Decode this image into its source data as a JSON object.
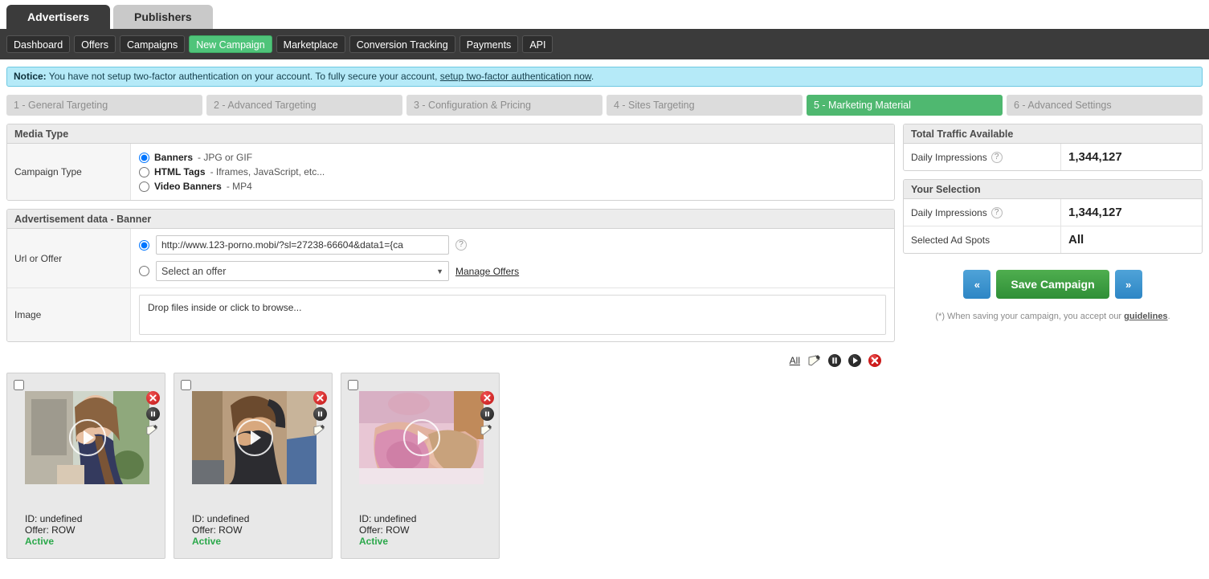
{
  "account_tabs": [
    {
      "label": "Advertisers",
      "active": true
    },
    {
      "label": "Publishers",
      "active": false
    }
  ],
  "nav": {
    "items": [
      {
        "label": "Dashboard",
        "selected": false
      },
      {
        "label": "Offers",
        "selected": false
      },
      {
        "label": "Campaigns",
        "selected": false
      },
      {
        "label": "New Campaign",
        "selected": true
      },
      {
        "label": "Marketplace",
        "selected": false
      },
      {
        "label": "Conversion Tracking",
        "selected": false
      },
      {
        "label": "Payments",
        "selected": false
      },
      {
        "label": "API",
        "selected": false
      }
    ],
    "selected_color": "#4fc47a"
  },
  "notice": {
    "prefix": "Notice:",
    "text": " You have not setup two-factor authentication on your account. To fully secure your account, ",
    "link": "setup two-factor authentication now",
    "suffix": ".",
    "background": "#b5eaf8"
  },
  "steps": [
    {
      "label": "1 - General Targeting",
      "active": false
    },
    {
      "label": "2 - Advanced Targeting",
      "active": false
    },
    {
      "label": "3 - Configuration & Pricing",
      "active": false
    },
    {
      "label": "4 - Sites Targeting",
      "active": false
    },
    {
      "label": "5 - Marketing Material",
      "active": true
    },
    {
      "label": "6 - Advanced Settings",
      "active": false
    }
  ],
  "media_type": {
    "panel_title": "Media Type",
    "row_label": "Campaign Type",
    "options": [
      {
        "name": "Banners",
        "rest": " - JPG or GIF",
        "checked": true
      },
      {
        "name": "HTML Tags",
        "rest": " - Iframes, JavaScript, etc...",
        "checked": false
      },
      {
        "name": "Video Banners",
        "rest": " - MP4",
        "checked": false
      }
    ]
  },
  "ad_data": {
    "panel_title": "Advertisement data - Banner",
    "url_row_label": "Url or Offer",
    "url_value": "http://www.123-porno.mobi/?sl=27238-66604&data1={ca",
    "url_radio_checked": true,
    "offer_select_value": "Select an offer",
    "offer_radio_checked": false,
    "manage_offers_link": "Manage Offers",
    "image_row_label": "Image",
    "dropzone_text": "Drop files inside or click to browse..."
  },
  "total_traffic": {
    "panel_title": "Total Traffic Available",
    "rows": [
      {
        "label": "Daily Impressions",
        "help": true,
        "value": "1,344,127"
      }
    ]
  },
  "your_selection": {
    "panel_title": "Your Selection",
    "rows": [
      {
        "label": "Daily Impressions",
        "help": true,
        "value": "1,344,127"
      },
      {
        "label": "Selected Ad Spots",
        "help": false,
        "value": "All"
      }
    ]
  },
  "actions": {
    "prev_label": "«",
    "save_label": "Save Campaign",
    "next_label": "»",
    "save_color": "#2f8f37",
    "nav_color": "#2e86c5",
    "disclaimer_prefix": "(*) When saving your campaign, you accept our ",
    "disclaimer_link": "guidelines",
    "disclaimer_suffix": "."
  },
  "banner_toolbar": {
    "all_label": "All",
    "icons": [
      "edit-icon",
      "pause-icon",
      "play-icon",
      "delete-icon"
    ]
  },
  "banner_cards": [
    {
      "id_label": "ID: undefined",
      "offer_label": "Offer: ROW",
      "status": "Active",
      "status_color": "#2aa84a"
    },
    {
      "id_label": "ID: undefined",
      "offer_label": "Offer: ROW",
      "status": "Active",
      "status_color": "#2aa84a"
    },
    {
      "id_label": "ID: undefined",
      "offer_label": "Offer: ROW",
      "status": "Active",
      "status_color": "#2aa84a"
    }
  ]
}
